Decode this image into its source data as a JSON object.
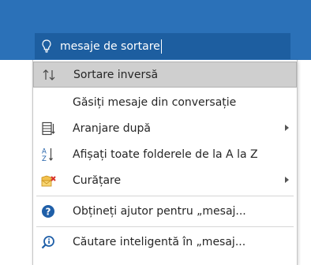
{
  "search": {
    "query": "mesaje de sortare",
    "icon": "lightbulb-icon"
  },
  "menu": {
    "items": [
      {
        "label": "Sortare inversă",
        "icon": "sort-reverse-icon",
        "highlighted": true,
        "submenu": false
      },
      {
        "label": "Găsiți mesaje din conversație",
        "icon": "",
        "highlighted": false,
        "submenu": false
      },
      {
        "label": "Aranjare după",
        "icon": "arrange-by-icon",
        "highlighted": false,
        "submenu": true
      },
      {
        "label": "Afișați toate folderele de la A la Z",
        "icon": "sort-a-z-icon",
        "highlighted": false,
        "submenu": false
      },
      {
        "label": "Curățare",
        "icon": "cleanup-icon",
        "highlighted": false,
        "submenu": true
      },
      {
        "label": "Obțineți ajutor pentru „mesaj...",
        "icon": "help-icon",
        "highlighted": false,
        "submenu": false
      },
      {
        "label": "Căutare inteligentă în „mesaj...",
        "icon": "smart-lookup-icon",
        "highlighted": false,
        "submenu": false
      }
    ]
  },
  "colors": {
    "header": "#2b71b8",
    "search_box": "#1d5ea0",
    "highlight": "#cfcfcf",
    "help_blue": "#1f5fa8"
  }
}
